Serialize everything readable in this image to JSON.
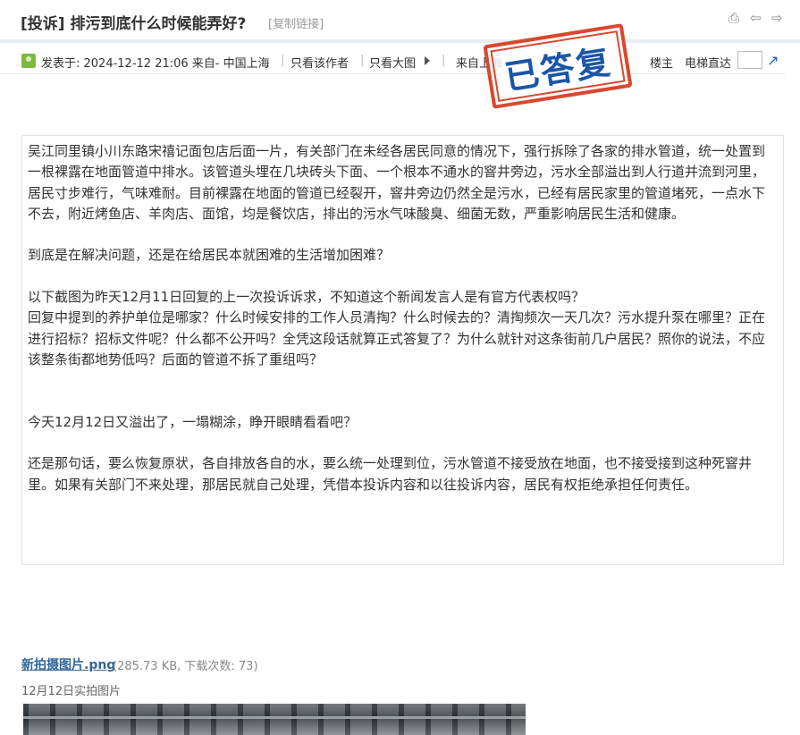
{
  "header": {
    "title": "[投诉] 排污到底什么时候能弄好?",
    "copy_link": "[复制链接]",
    "icons": [
      "print-icon",
      "prev-arrow-icon",
      "next-arrow-icon"
    ]
  },
  "meta": {
    "posted": "发表于: 2024-12-12 21:06 来自- 中国上海",
    "only_author": "只看该作者",
    "big_image": "只看大图",
    "source": "来自上海",
    "floor": "楼主",
    "elevator": "电梯直达"
  },
  "stamp": {
    "text": "已答复",
    "border_color": "#d9482f",
    "text_color": "#1a55a8"
  },
  "post": {
    "paragraphs": [
      "吴江同里镇小川东路宋禧记面包店后面一片，有关部门在未经各居民同意的情况下，强行拆除了各家的排水管道，统一处置到一根裸露在地面管道中排水。该管道头埋在几块砖头下面、一个根本不通水的窨井旁边，污水全部溢出到人行道并流到河里，居民寸步难行，气味难耐。目前裸露在地面的管道已经裂开，窨井旁边仍然全是污水，已经有居民家里的管道堵死，一点水下不去，附近烤鱼店、羊肉店、面馆，均是餐饮店，排出的污水气味酸臭、细菌无数，严重影响居民生活和健康。",
      "到底是在解决问题，还是在给居民本就困难的生活增加困难？",
      "以下截图为昨天12月11日回复的上一次投诉诉求，不知道这个新闻发言人是有官方代表权吗？",
      "回复中提到的养护单位是哪家？什么时候安排的工作人员清掏？什么时候去的？清掏频次一天几次？污水提升泵在哪里？正在进行招标？招标文件呢？什么都不公开吗？全凭这段话就算正式答复了？为什么就针对这条街前几户居民？照你的说法，不应该整条街都地势低吗？后面的管道不拆了重组吗？",
      "今天12月12日又溢出了，一塌糊涂，睁开眼睛看看吧？",
      "还是那句话，要么恢复原状，各自排放各自的水，要么统一处理到位，污水管道不接受放在地面，也不接受接到这种死窨井里。如果有关部门不来处理，那居民就自己处理，凭借本投诉内容和以往投诉内容，居民有权拒绝承担任何责任。"
    ]
  },
  "attachment": {
    "filename": "新拍摄图片.png",
    "info": "(285.73 KB, 下载次数: 73)",
    "caption": "12月12日实拍图片"
  }
}
